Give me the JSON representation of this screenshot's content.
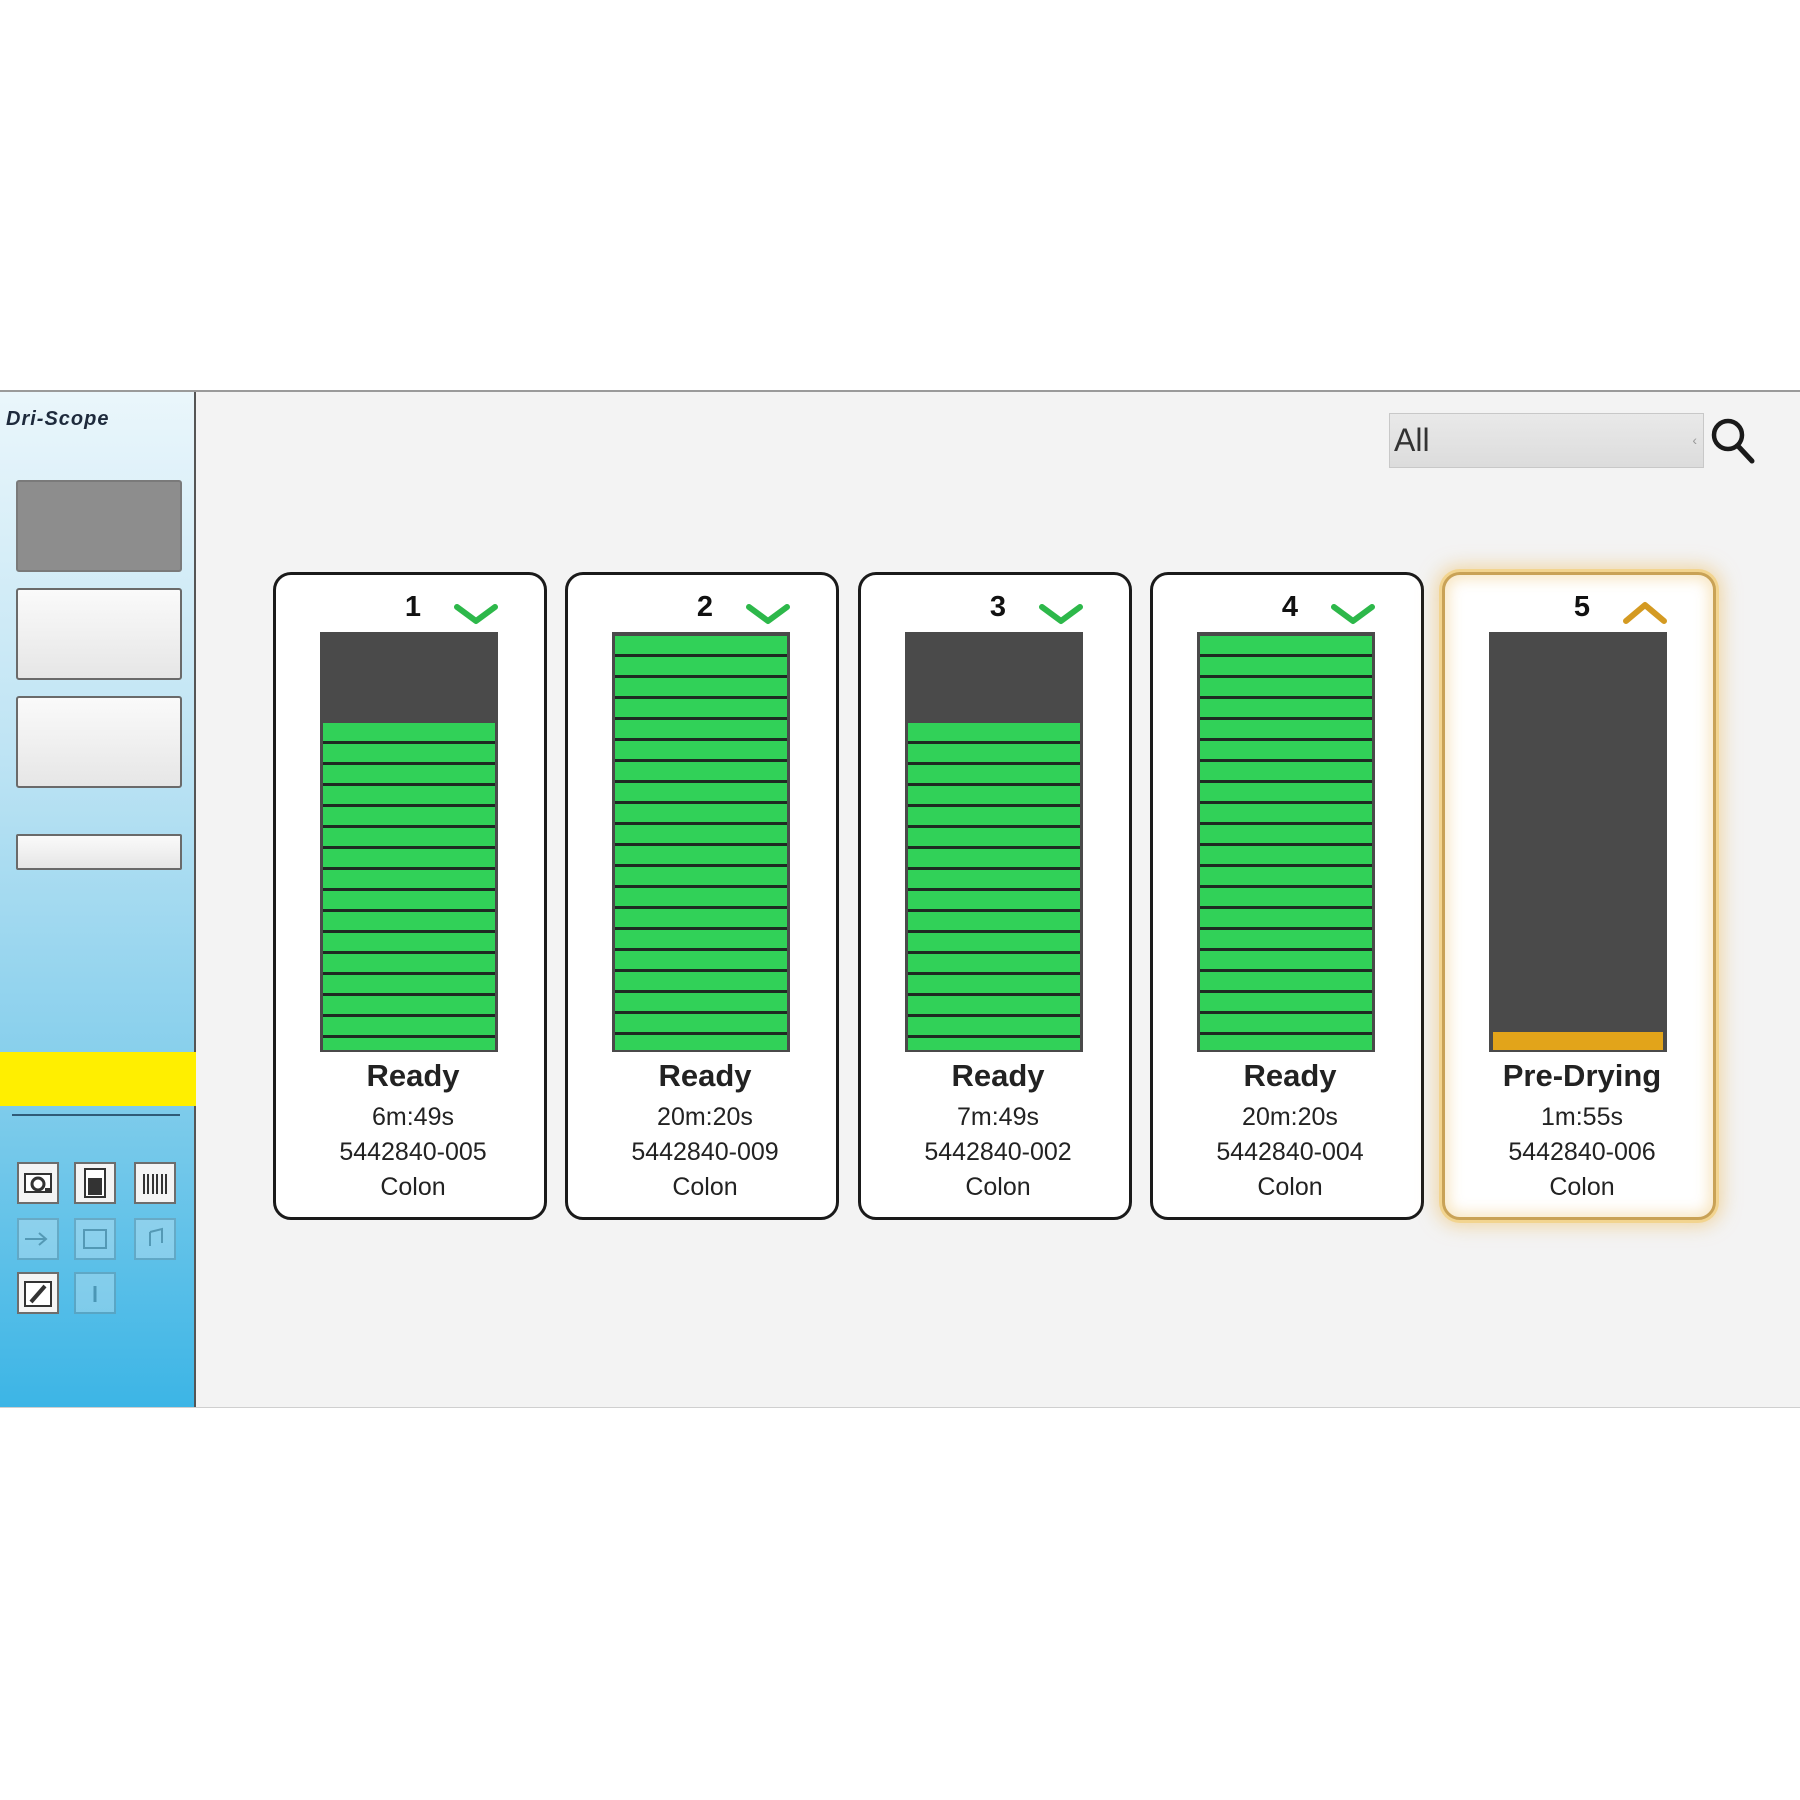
{
  "sidebar": {
    "brand_line1": "Dri-Scope",
    "brand_line2": "",
    "nav": {
      "status_label": "",
      "data_label": "",
      "settings_label": "",
      "shutdown_label": ""
    },
    "status_note": "",
    "warning_text": "",
    "system_title": "",
    "system_icons": [
      "printer-icon",
      "cabinet-icon",
      "barcode-icon",
      "export-icon",
      "folder-icon",
      "audio-icon",
      "edit-icon",
      "info-icon"
    ],
    "footer_line1": "",
    "footer_line2": ""
  },
  "search": {
    "value": "All"
  },
  "cabinets": [
    {
      "number": "1",
      "indicator": "check-icon",
      "state": "Ready",
      "time": "6m:49s",
      "id": "5442840-005",
      "type": "Colon",
      "fill": 0.79,
      "status_color": "#2db84a"
    },
    {
      "number": "2",
      "indicator": "check-icon",
      "state": "Ready",
      "time": "20m:20s",
      "id": "5442840-009",
      "type": "Colon",
      "fill": 1.0,
      "status_color": "#2db84a"
    },
    {
      "number": "3",
      "indicator": "check-icon",
      "state": "Ready",
      "time": "7m:49s",
      "id": "5442840-002",
      "type": "Colon",
      "fill": 0.79,
      "status_color": "#2db84a"
    },
    {
      "number": "4",
      "indicator": "check-icon",
      "state": "Ready",
      "time": "20m:20s",
      "id": "5442840-004",
      "type": "Colon",
      "fill": 1.0,
      "status_color": "#2db84a"
    },
    {
      "number": "5",
      "indicator": "chevron-up-icon",
      "state": "Pre-Drying",
      "time": "1m:55s",
      "id": "5442840-006",
      "type": "Colon",
      "fill": 0.05,
      "status_color": "#d49a22"
    }
  ],
  "colors": {
    "gauge_green": "#31d158",
    "gauge_empty": "#4a4a4a",
    "predry_orange": "#e2a41a",
    "warning_yellow": "#ffef00",
    "sidebar_blue": "#3cb5e6"
  }
}
